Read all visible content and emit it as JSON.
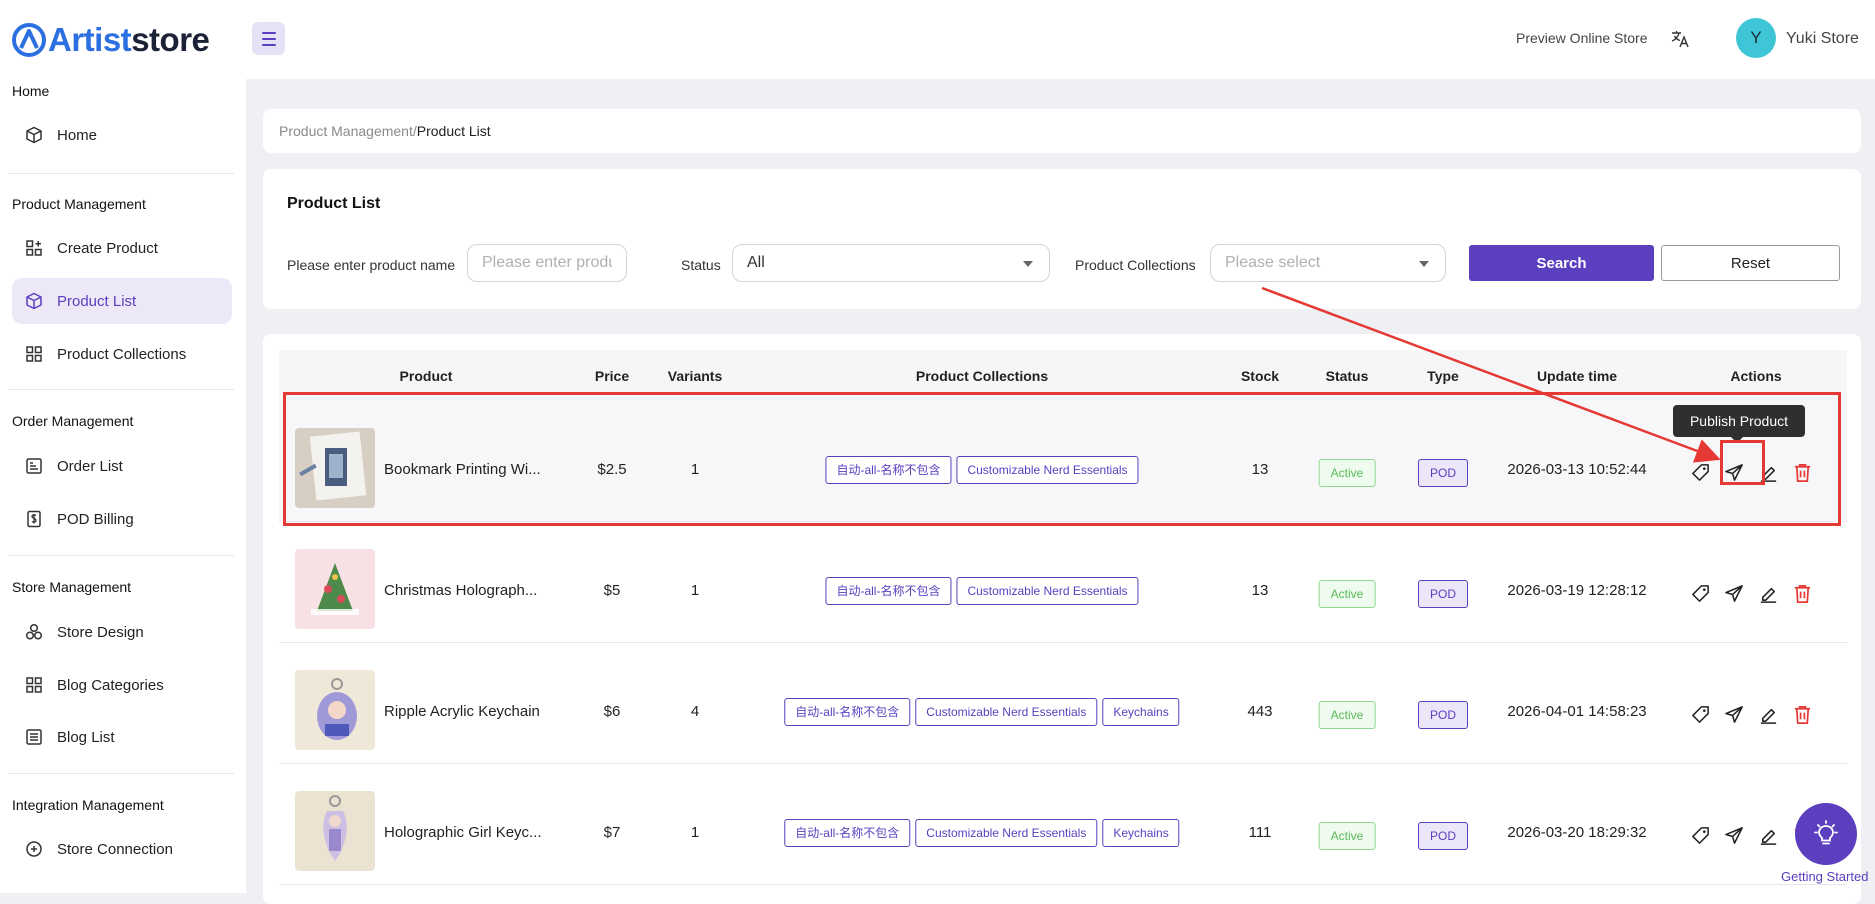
{
  "brand": {
    "name_part1": "Artist",
    "name_part2": "store"
  },
  "topbar": {
    "preview_link": "Preview Online Store",
    "avatar_initial": "Y",
    "user_name": "Yuki Store"
  },
  "sidebar": {
    "groups": [
      {
        "title": "Home",
        "items": [
          {
            "label": "Home",
            "icon": "cube-icon"
          }
        ]
      },
      {
        "title": "Product Management",
        "items": [
          {
            "label": "Create Product",
            "icon": "grid-plus-icon"
          },
          {
            "label": "Product List",
            "icon": "cube-icon",
            "active": true
          },
          {
            "label": "Product Collections",
            "icon": "grid-icon"
          }
        ]
      },
      {
        "title": "Order Management",
        "items": [
          {
            "label": "Order List",
            "icon": "list-icon"
          },
          {
            "label": "POD Billing",
            "icon": "dollar-doc-icon"
          }
        ]
      },
      {
        "title": "Store Management",
        "items": [
          {
            "label": "Store Design",
            "icon": "design-icon"
          },
          {
            "label": "Blog Categories",
            "icon": "grid-icon"
          },
          {
            "label": "Blog List",
            "icon": "doc-list-icon"
          }
        ]
      },
      {
        "title": "Integration Management",
        "items": [
          {
            "label": "Store Connection",
            "icon": "link-icon"
          }
        ]
      }
    ]
  },
  "breadcrumb": {
    "parent": "Product Management",
    "separator": "/",
    "current": "Product List"
  },
  "filters": {
    "title": "Product List",
    "name_label": "Please enter product name",
    "name_placeholder": "Please enter product n",
    "status_label": "Status",
    "status_value": "All",
    "collections_label": "Product Collections",
    "collections_placeholder": "Please select",
    "search_button": "Search",
    "reset_button": "Reset"
  },
  "table": {
    "headers": {
      "product": "Product",
      "price": "Price",
      "variants": "Variants",
      "collections": "Product Collections",
      "stock": "Stock",
      "status": "Status",
      "type": "Type",
      "update_time": "Update time",
      "actions": "Actions"
    },
    "rows": [
      {
        "name": "Bookmark Printing Wi...",
        "price": "$2.5",
        "variants": "1",
        "collections": [
          "自动-all-名称不包含",
          "Customizable Nerd Essentials"
        ],
        "stock": "13",
        "status": "Active",
        "type": "POD",
        "updated": "2026-03-13 10:52:44"
      },
      {
        "name": "Christmas Holograph...",
        "price": "$5",
        "variants": "1",
        "collections": [
          "自动-all-名称不包含",
          "Customizable Nerd Essentials"
        ],
        "stock": "13",
        "status": "Active",
        "type": "POD",
        "updated": "2026-03-19 12:28:12"
      },
      {
        "name": "Ripple Acrylic Keychain",
        "price": "$6",
        "variants": "4",
        "collections": [
          "自动-all-名称不包含",
          "Customizable Nerd Essentials",
          "Keychains"
        ],
        "stock": "443",
        "status": "Active",
        "type": "POD",
        "updated": "2026-04-01 14:58:23"
      },
      {
        "name": "Holographic Girl Keyc...",
        "price": "$7",
        "variants": "1",
        "collections": [
          "自动-all-名称不包含",
          "Customizable Nerd Essentials",
          "Keychains"
        ],
        "stock": "111",
        "status": "Active",
        "type": "POD",
        "updated": "2026-03-20 18:29:32"
      }
    ]
  },
  "tooltip": "Publish Product",
  "getting_started": "Getting Started",
  "colors": {
    "accent": "#5b3fbf",
    "danger": "#e53935",
    "active_green": "#5aba5a",
    "brand_blue": "#2b6fe0"
  }
}
